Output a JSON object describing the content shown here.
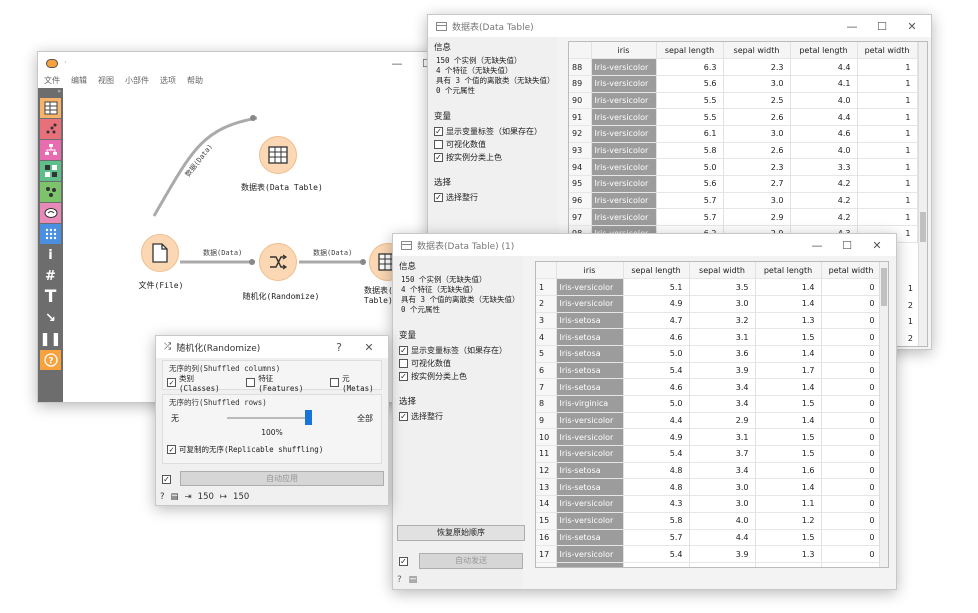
{
  "main_window": {
    "menu": [
      "文件",
      "编辑",
      "视图",
      "小部件",
      "选项",
      "帮助"
    ],
    "nodes": {
      "file": "文件(File)",
      "datatable1": "数据表(Data Table)",
      "randomize": "随机化(Randomize)",
      "datatable2": "数据表(Data Table) (1)"
    },
    "links": {
      "file_to_dt": "数据(Data)",
      "file_to_rand": "数据(Data)",
      "rand_to_dt": "数据(Data)"
    },
    "toolbar_icons": [
      "table-icon",
      "scatter-icon",
      "tree-icon",
      "matrix-icon",
      "cluster-icon",
      "brain-icon",
      "dots-icon",
      "info-icon",
      "hash-icon",
      "text-icon",
      "arrow-icon",
      "pause-icon",
      "help-icon"
    ]
  },
  "dt1": {
    "title": "数据表(Data Table)",
    "info_header": "信息",
    "info_lines": [
      "150 个实例（无缺失值）",
      "4 个特征（无缺失值）",
      "具有 3 个值的离散类（无缺失值）",
      "0 个元属性"
    ],
    "variables_header": "变量",
    "checks": [
      {
        "label": "显示变量标签（如果存在）",
        "checked": "✓"
      },
      {
        "label": "可视化数值",
        "checked": ""
      },
      {
        "label": "按实例分类上色",
        "checked": "✓"
      }
    ],
    "select_header": "选择",
    "select_rows_label": "选择整行",
    "select_rows_checked": "✓",
    "columns": [
      "iris",
      "sepal length",
      "sepal width",
      "petal length",
      "petal width"
    ],
    "rows": [
      {
        "n": "88",
        "iris": "Iris-versicolor",
        "sl": "6.3",
        "sw": "2.3",
        "pl": "4.4",
        "pw": "1"
      },
      {
        "n": "89",
        "iris": "Iris-versicolor",
        "sl": "5.6",
        "sw": "3.0",
        "pl": "4.1",
        "pw": "1"
      },
      {
        "n": "90",
        "iris": "Iris-versicolor",
        "sl": "5.5",
        "sw": "2.5",
        "pl": "4.0",
        "pw": "1"
      },
      {
        "n": "91",
        "iris": "Iris-versicolor",
        "sl": "5.5",
        "sw": "2.6",
        "pl": "4.4",
        "pw": "1"
      },
      {
        "n": "92",
        "iris": "Iris-versicolor",
        "sl": "6.1",
        "sw": "3.0",
        "pl": "4.6",
        "pw": "1"
      },
      {
        "n": "93",
        "iris": "Iris-versicolor",
        "sl": "5.8",
        "sw": "2.6",
        "pl": "4.0",
        "pw": "1"
      },
      {
        "n": "94",
        "iris": "Iris-versicolor",
        "sl": "5.0",
        "sw": "2.3",
        "pl": "3.3",
        "pw": "1"
      },
      {
        "n": "95",
        "iris": "Iris-versicolor",
        "sl": "5.6",
        "sw": "2.7",
        "pl": "4.2",
        "pw": "1"
      },
      {
        "n": "96",
        "iris": "Iris-versicolor",
        "sl": "5.7",
        "sw": "3.0",
        "pl": "4.2",
        "pw": "1"
      },
      {
        "n": "97",
        "iris": "Iris-versicolor",
        "sl": "5.7",
        "sw": "2.9",
        "pl": "4.2",
        "pw": "1"
      },
      {
        "n": "98",
        "iris": "Iris-versicolor",
        "sl": "6.2",
        "sw": "2.9",
        "pl": "4.3",
        "pw": "1"
      }
    ],
    "right_edge_values": [
      "1",
      "2",
      "1",
      "2",
      "1"
    ]
  },
  "dt2": {
    "title": "数据表(Data Table) (1)",
    "info_header": "信息",
    "info_lines": [
      "150 个实例（无缺失值）",
      "4 个特征（无缺失值）",
      "具有 3 个值的离散类（无缺失值）",
      "0 个元属性"
    ],
    "variables_header": "变量",
    "checks": [
      {
        "label": "显示变量标签（如果存在）",
        "checked": "✓"
      },
      {
        "label": "可视化数值",
        "checked": ""
      },
      {
        "label": "按实例分类上色",
        "checked": "✓"
      }
    ],
    "select_header": "选择",
    "select_rows_label": "选择整行",
    "select_rows_checked": "✓",
    "restore_button": "恢复原始顺序",
    "autosend_label": "自动发送",
    "autosend_checked": "✓",
    "columns": [
      "iris",
      "sepal length",
      "sepal width",
      "petal length",
      "petal width"
    ],
    "rows": [
      {
        "n": "1",
        "iris": "Iris-versicolor",
        "sl": "5.1",
        "sw": "3.5",
        "pl": "1.4",
        "pw": "0"
      },
      {
        "n": "2",
        "iris": "Iris-versicolor",
        "sl": "4.9",
        "sw": "3.0",
        "pl": "1.4",
        "pw": "0"
      },
      {
        "n": "3",
        "iris": "Iris-setosa",
        "sl": "4.7",
        "sw": "3.2",
        "pl": "1.3",
        "pw": "0"
      },
      {
        "n": "4",
        "iris": "Iris-setosa",
        "sl": "4.6",
        "sw": "3.1",
        "pl": "1.5",
        "pw": "0"
      },
      {
        "n": "5",
        "iris": "Iris-setosa",
        "sl": "5.0",
        "sw": "3.6",
        "pl": "1.4",
        "pw": "0"
      },
      {
        "n": "6",
        "iris": "Iris-setosa",
        "sl": "5.4",
        "sw": "3.9",
        "pl": "1.7",
        "pw": "0"
      },
      {
        "n": "7",
        "iris": "Iris-setosa",
        "sl": "4.6",
        "sw": "3.4",
        "pl": "1.4",
        "pw": "0"
      },
      {
        "n": "8",
        "iris": "Iris-virginica",
        "sl": "5.0",
        "sw": "3.4",
        "pl": "1.5",
        "pw": "0"
      },
      {
        "n": "9",
        "iris": "Iris-versicolor",
        "sl": "4.4",
        "sw": "2.9",
        "pl": "1.4",
        "pw": "0"
      },
      {
        "n": "10",
        "iris": "Iris-versicolor",
        "sl": "4.9",
        "sw": "3.1",
        "pl": "1.5",
        "pw": "0"
      },
      {
        "n": "11",
        "iris": "Iris-versicolor",
        "sl": "5.4",
        "sw": "3.7",
        "pl": "1.5",
        "pw": "0"
      },
      {
        "n": "12",
        "iris": "Iris-setosa",
        "sl": "4.8",
        "sw": "3.4",
        "pl": "1.6",
        "pw": "0"
      },
      {
        "n": "13",
        "iris": "Iris-setosa",
        "sl": "4.8",
        "sw": "3.0",
        "pl": "1.4",
        "pw": "0"
      },
      {
        "n": "14",
        "iris": "Iris-versicolor",
        "sl": "4.3",
        "sw": "3.0",
        "pl": "1.1",
        "pw": "0"
      },
      {
        "n": "15",
        "iris": "Iris-versicolor",
        "sl": "5.8",
        "sw": "4.0",
        "pl": "1.2",
        "pw": "0"
      },
      {
        "n": "16",
        "iris": "Iris-setosa",
        "sl": "5.7",
        "sw": "4.4",
        "pl": "1.5",
        "pw": "0"
      },
      {
        "n": "17",
        "iris": "Iris-versicolor",
        "sl": "5.4",
        "sw": "3.9",
        "pl": "1.3",
        "pw": "0"
      },
      {
        "n": "18",
        "iris": "Iris-virginica",
        "sl": "5.1",
        "sw": "3.5",
        "pl": "1.4",
        "pw": "0"
      },
      {
        "n": "19",
        "iris": "Iris-versicolor",
        "sl": "5.7",
        "sw": "3.8",
        "pl": "1.7",
        "pw": "0"
      },
      {
        "n": "20",
        "iris": "Iris-virginica",
        "sl": "5.1",
        "sw": "3.8",
        "pl": "1.5",
        "pw": "0"
      }
    ]
  },
  "randomize": {
    "title": "随机化(Randomize)",
    "help": "?",
    "columns_group": "无序的列(Shuffled columns)",
    "col_checks": [
      {
        "label": "类别(Classes)",
        "checked": "✓"
      },
      {
        "label": "特征(Features)",
        "checked": ""
      },
      {
        "label": "元(Metas)",
        "checked": ""
      }
    ],
    "rows_group": "无序的行(Shuffled rows)",
    "slider_min": "无",
    "slider_max": "全部",
    "slider_value": "100%",
    "slider_fraction": 1.0,
    "replicable_label": "可复制的无序(Replicable shuffling)",
    "replicable_checked": "✓",
    "autoapply_checked": "✓",
    "autoapply_label": "自动应用",
    "input_count": "150",
    "output_count": "150"
  }
}
